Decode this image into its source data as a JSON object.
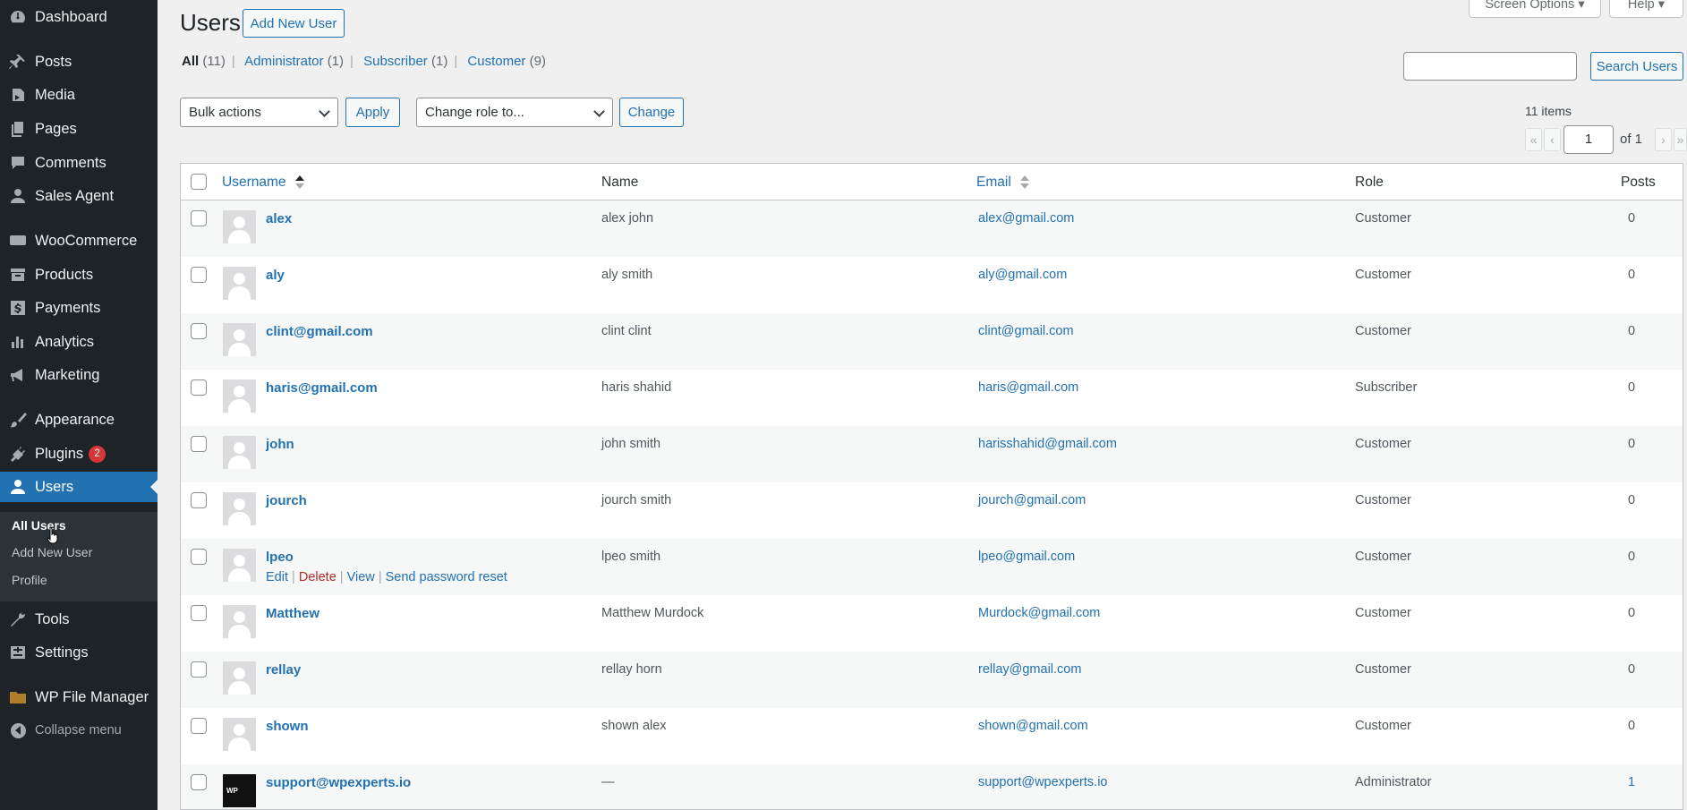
{
  "sidebar": {
    "items": [
      {
        "label": "Dashboard",
        "icon": "dashboard-icon"
      },
      {
        "label": "Posts",
        "icon": "pin-icon"
      },
      {
        "label": "Media",
        "icon": "media-icon"
      },
      {
        "label": "Pages",
        "icon": "pages-icon"
      },
      {
        "label": "Comments",
        "icon": "comment-icon"
      },
      {
        "label": "Sales Agent",
        "icon": "user-icon"
      },
      {
        "label": "WooCommerce",
        "icon": "woo-icon"
      },
      {
        "label": "Products",
        "icon": "archive-icon"
      },
      {
        "label": "Payments",
        "icon": "dollar-icon"
      },
      {
        "label": "Analytics",
        "icon": "bar-chart-icon"
      },
      {
        "label": "Marketing",
        "icon": "megaphone-icon"
      },
      {
        "label": "Appearance",
        "icon": "brush-icon"
      },
      {
        "label": "Plugins",
        "icon": "plug-icon",
        "badge": "2"
      },
      {
        "label": "Users",
        "icon": "users-icon"
      },
      {
        "label": "Tools",
        "icon": "wrench-icon"
      },
      {
        "label": "Settings",
        "icon": "settings-icon"
      },
      {
        "label": "WP File Manager",
        "icon": "folder-icon"
      }
    ],
    "submenu": [
      {
        "label": "All Users"
      },
      {
        "label": "Add New User"
      },
      {
        "label": "Profile"
      }
    ],
    "collapse_label": "Collapse menu"
  },
  "header": {
    "title": "Users",
    "add_new_label": "Add New User",
    "screen_options_label": "Screen Options",
    "help_label": "Help"
  },
  "filters": {
    "all": "All",
    "all_count": "(11)",
    "admin": "Administrator",
    "admin_count": "(1)",
    "subscriber": "Subscriber",
    "subscriber_count": "(1)",
    "customer": "Customer",
    "customer_count": "(9)"
  },
  "search": {
    "placeholder": "",
    "button_label": "Search Users"
  },
  "bulk": {
    "selected": "Bulk actions",
    "apply_label": "Apply",
    "role_selected": "Change role to...",
    "change_label": "Change"
  },
  "pagination": {
    "items_text": "11 items",
    "current_page": "1",
    "of_text": "of 1",
    "first": "«",
    "prev": "‹",
    "next": "›",
    "last": "»"
  },
  "table": {
    "columns": {
      "username": "Username",
      "name": "Name",
      "email": "Email",
      "role": "Role",
      "posts": "Posts"
    },
    "rows": [
      {
        "username": "alex",
        "name": "alex john",
        "email": "alex@gmail.com",
        "role": "Customer",
        "posts": "0"
      },
      {
        "username": "aly",
        "name": "aly smith",
        "email": "aly@gmail.com",
        "role": "Customer",
        "posts": "0"
      },
      {
        "username": "clint@gmail.com",
        "name": "clint clint",
        "email": "clint@gmail.com",
        "role": "Customer",
        "posts": "0"
      },
      {
        "username": "haris@gmail.com",
        "name": "haris shahid",
        "email": "haris@gmail.com",
        "role": "Subscriber",
        "posts": "0"
      },
      {
        "username": "john",
        "name": "john smith",
        "email": "harisshahid@gmail.com",
        "role": "Customer",
        "posts": "0"
      },
      {
        "username": "jourch",
        "name": "jourch smith",
        "email": "jourch@gmail.com",
        "role": "Customer",
        "posts": "0"
      },
      {
        "username": "lpeo",
        "name": "lpeo smith",
        "email": "lpeo@gmail.com",
        "role": "Customer",
        "posts": "0"
      },
      {
        "username": "Matthew",
        "name": "Matthew Murdock",
        "email": "Murdock@gmail.com",
        "role": "Customer",
        "posts": "0"
      },
      {
        "username": "rellay",
        "name": "rellay horn",
        "email": "rellay@gmail.com",
        "role": "Customer",
        "posts": "0"
      },
      {
        "username": "shown",
        "name": "shown alex",
        "email": "shown@gmail.com",
        "role": "Customer",
        "posts": "0"
      },
      {
        "username": "support@wpexperts.io",
        "name": "—",
        "email": "support@wpexperts.io",
        "role": "Administrator",
        "posts": "1"
      }
    ],
    "row_actions": {
      "edit": "Edit",
      "delete": "Delete",
      "view": "View",
      "reset": "Send password reset",
      "sep": "|"
    }
  },
  "colors": {
    "sidebar_bg": "#1d2327",
    "accent": "#2271b1",
    "danger": "#d63638"
  }
}
